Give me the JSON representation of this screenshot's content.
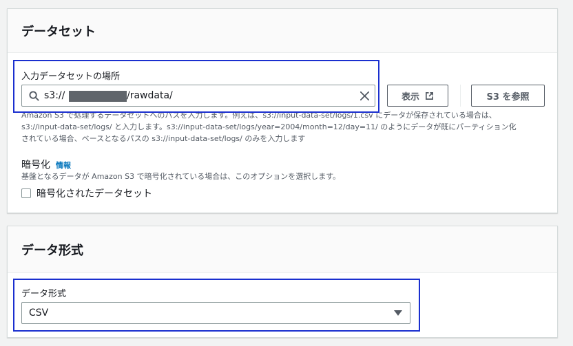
{
  "dataset": {
    "title": "データセット",
    "location_label": "入力データセットの場所",
    "location_value_prefix": "s3://",
    "location_value_suffix": "/rawdata/",
    "view_button": "表示",
    "browse_button": "S3 を参照",
    "description_lines": [
      "Amazon S3 で処理するデータセットへのパスを入力します。例えば、s3://input-data-set/logs/1.csv にデータが保存されている場合は、",
      "s3://input-data-set/logs/ と入力します。s3://input-data-set/logs/year=2004/month=12/day=11/ のようにデータが既にパーティション化",
      "されている場合、ベースとなるパスの s3://input-data-set/logs/ のみを入力します"
    ],
    "encryption_label": "暗号化",
    "encryption_info_link": "情報",
    "encryption_description": "基盤となるデータが Amazon S3 で暗号化されている場合は、このオプションを選択します。",
    "encrypted_checkbox_label": "暗号化されたデータセット",
    "encrypted_checked": false
  },
  "format": {
    "title": "データ形式",
    "format_label": "データ形式",
    "selected": "CSV"
  },
  "colors": {
    "link": "#0073bb",
    "highlight": "#1a2fcf"
  },
  "icons": {
    "search": "search-icon",
    "clear": "close-icon",
    "external": "external-link-icon",
    "dropdown": "caret-down-icon"
  }
}
